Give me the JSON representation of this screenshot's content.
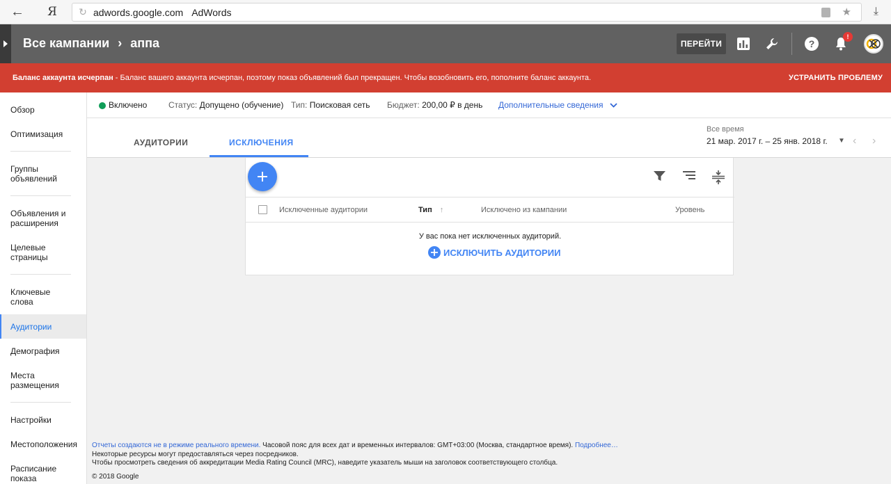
{
  "browser": {
    "back_glyph": "←",
    "yandex_glyph": "Я",
    "url_domain": "adwords.google.com",
    "page_title": "AdWords",
    "reload_glyph": "↻",
    "star_glyph": "★",
    "download_glyph": "⤓"
  },
  "header": {
    "breadcrumb_root": "Все кампании",
    "breadcrumb_sep": "›",
    "breadcrumb_current": "аппа",
    "goto_label": "ПЕРЕЙТИ",
    "notification_count": "!",
    "help_glyph": "?"
  },
  "alert": {
    "bold_text": "Баланс аккаунта исчерпан",
    "text": " - Баланс вашего аккаунта исчерпан, поэтому показ объявлений был прекращен. Чтобы возобновить его, пополните баланс аккаунта.",
    "fix_label": "УСТРАНИТЬ ПРОБЛЕМУ",
    "color": "#d23f31"
  },
  "sidebar": {
    "items": [
      {
        "label": "Обзор"
      },
      {
        "label": "Оптимизация"
      },
      {
        "label": "Группы объявлений"
      },
      {
        "label": "Объявления и расширения"
      },
      {
        "label": "Целевые страницы"
      },
      {
        "label": "Ключевые слова"
      },
      {
        "label": "Аудитории",
        "active": true
      },
      {
        "label": "Демография"
      },
      {
        "label": "Места размещения"
      },
      {
        "label": "Настройки"
      },
      {
        "label": "Местоположения"
      },
      {
        "label": "Расписание показа"
      }
    ]
  },
  "status": {
    "state": "Включено",
    "state_color": "#0f9d58",
    "status_label": "Статус:",
    "status_value": "Допущено (обучение)",
    "type_label": "Тип:",
    "type_value": "Поисковая сеть",
    "budget_label": "Бюджет:",
    "budget_value": "200,00 ₽ в день",
    "more_label": "Дополнительные сведения"
  },
  "tabs": [
    {
      "label": "АУДИТОРИИ",
      "active": false
    },
    {
      "label": "ИСКЛЮЧЕНИЯ",
      "active": true
    }
  ],
  "date": {
    "label": "Все время",
    "range": "21 мар. 2017 г. – 25 янв. 2018 г."
  },
  "table": {
    "columns": [
      "Исключенные аудитории",
      "Тип",
      "Исключено из кампании",
      "Уровень"
    ],
    "sort_glyph": "↑",
    "empty_message": "У вас пока нет исключенных аудиторий.",
    "exclude_label": "ИСКЛЮЧИТЬ АУДИТОРИИ"
  },
  "footer": {
    "link1": "Отчеты создаются не в режиме реального времени.",
    "line1_text": " Часовой пояс для всех дат и временных интервалов: GMT+03:00 (Москва, стандартное время). ",
    "link2": "Подробнее…",
    "line2": "Некоторые ресурсы могут предоставляться через посредников.",
    "line3": "Чтобы просмотреть сведения об аккредитации Media Rating Council (MRC), наведите указатель мыши на заголовок соответствующего столбца.",
    "copyright": "© 2018 Google"
  },
  "colors": {
    "accent": "#4285f4",
    "header_bg": "#616161"
  }
}
